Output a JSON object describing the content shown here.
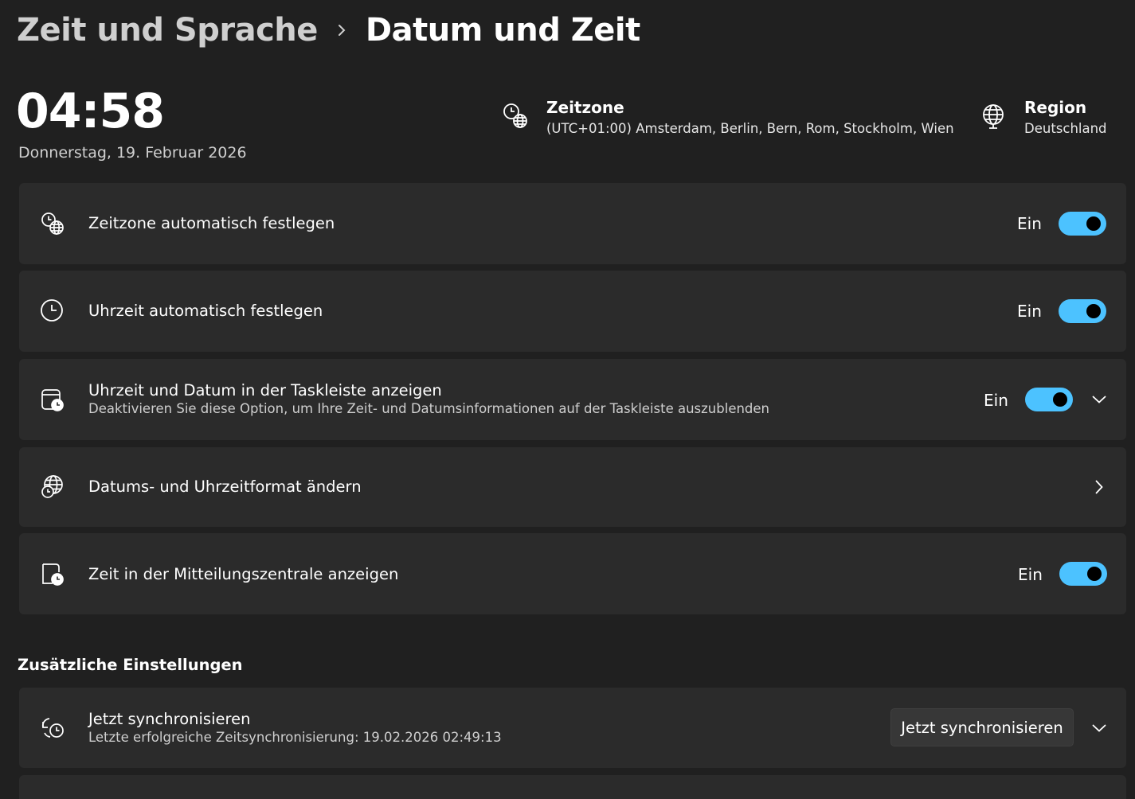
{
  "breadcrumb": {
    "parent": "Zeit und Sprache",
    "current": "Datum und Zeit"
  },
  "clock": {
    "time": "04:58",
    "date": "Donnerstag, 19. Februar 2026"
  },
  "timezone": {
    "title": "Zeitzone",
    "value": "(UTC+01:00) Amsterdam, Berlin, Bern, Rom, Stockholm, Wien",
    "icon": "clock-globe-icon"
  },
  "region": {
    "title": "Region",
    "value": "Deutschland",
    "icon": "globe-icon"
  },
  "settings": [
    {
      "title": "Zeitzone automatisch festlegen",
      "state": "Ein",
      "toggle_on": true,
      "icon": "clock-globe-icon"
    },
    {
      "title": "Uhrzeit automatisch festlegen",
      "state": "Ein",
      "toggle_on": true,
      "icon": "clock-icon"
    },
    {
      "title": "Uhrzeit und Datum in der Taskleiste anzeigen",
      "description": "Deaktivieren Sie diese Option, um Ihre Zeit- und Datumsinformationen auf der Taskleiste auszublenden",
      "state": "Ein",
      "toggle_on": true,
      "icon": "calendar-clock-icon",
      "expandable": true
    },
    {
      "title": "Datums- und Uhrzeitformat ändern",
      "icon": "globe-clock-icon",
      "navigates": true
    },
    {
      "title": "Zeit in der Mitteilungszentrale anzeigen",
      "state": "Ein",
      "toggle_on": true,
      "icon": "notification-clock-icon"
    }
  ],
  "additional": {
    "heading": "Zusätzliche Einstellungen",
    "sync": {
      "title": "Jetzt synchronisieren",
      "description": "Letzte erfolgreiche Zeitsynchronisierung: 19.02.2026 02:49:13",
      "button_label": "Jetzt synchronisieren",
      "icon": "sync-clock-icon"
    }
  },
  "colors": {
    "background": "#202020",
    "card": "#2b2b2b",
    "accent": "#4cc2ff"
  }
}
